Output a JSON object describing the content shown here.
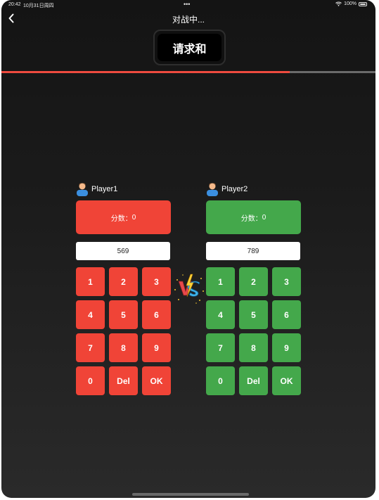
{
  "status_bar": {
    "time": "20:42",
    "date": "10月31日周四",
    "dots": "•••",
    "battery": "100%"
  },
  "nav": {
    "title": "对战中...",
    "back_icon": "chevron-left-icon"
  },
  "draw_button": {
    "label": "请求和"
  },
  "progress": {
    "fraction": 0.77,
    "fill_color": "#ee4b3f",
    "track_color": "#6b6b6b"
  },
  "players": [
    {
      "name": "Player1",
      "score_label": "分数：",
      "score": "0",
      "input_value": "569",
      "color": "#f04437",
      "keys": [
        "1",
        "2",
        "3",
        "4",
        "5",
        "6",
        "7",
        "8",
        "9",
        "0",
        "Del",
        "OK"
      ]
    },
    {
      "name": "Player2",
      "score_label": "分数：",
      "score": "0",
      "input_value": "789",
      "color": "#44a84b",
      "keys": [
        "1",
        "2",
        "3",
        "4",
        "5",
        "6",
        "7",
        "8",
        "9",
        "0",
        "Del",
        "OK"
      ]
    }
  ],
  "vs_icon": "vs-icon"
}
